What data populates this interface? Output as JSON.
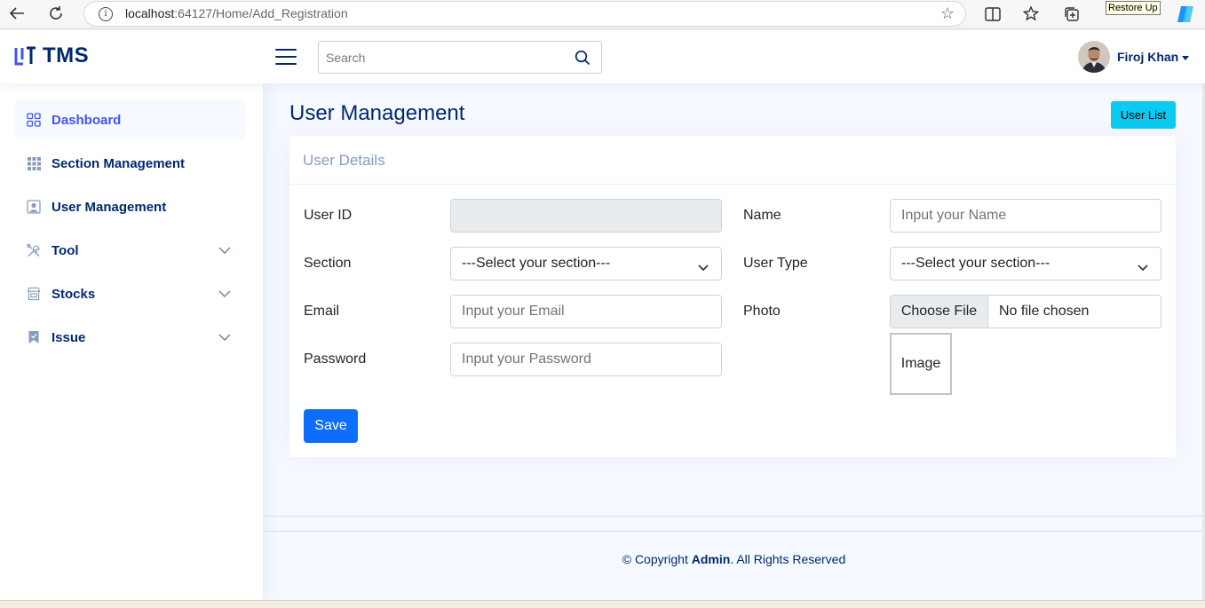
{
  "browser": {
    "url_host": "localhost",
    "url_path": ":64127/Home/Add_Registration",
    "tooltip": "Restore Up"
  },
  "header": {
    "logo_text": "TMS",
    "search_placeholder": "Search",
    "user_name": "Firoj Khan"
  },
  "sidebar": {
    "items": [
      {
        "label": "Dashboard",
        "icon": "grid-icon",
        "active": true
      },
      {
        "label": "Section Management",
        "icon": "apps-grid-icon"
      },
      {
        "label": "User Management",
        "icon": "person-badge-icon"
      },
      {
        "label": "Tool",
        "icon": "tools-icon",
        "expandable": true
      },
      {
        "label": "Stocks",
        "icon": "shop-icon",
        "expandable": true
      },
      {
        "label": "Issue",
        "icon": "bookmark-icon",
        "expandable": true
      }
    ]
  },
  "main": {
    "title": "User Management",
    "user_list_button": "User List",
    "card_title": "User Details",
    "fields": {
      "user_id_label": "User ID",
      "user_id_value": "",
      "name_label": "Name",
      "name_placeholder": "Input your Name",
      "section_label": "Section",
      "section_value": "---Select your section---",
      "user_type_label": "User Type",
      "user_type_value": "---Select your section---",
      "email_label": "Email",
      "email_placeholder": "Input your Email",
      "photo_label": "Photo",
      "file_button": "Choose File",
      "file_status": "No file chosen",
      "password_label": "Password",
      "password_placeholder": "Input your Password",
      "image_placeholder": "Image"
    },
    "save_button": "Save"
  },
  "footer": {
    "prefix": "© Copyright ",
    "owner": "Admin",
    "suffix": ". All Rights Reserved"
  },
  "colors": {
    "primary": "#012970",
    "accent": "#4154f1",
    "save_button": "#0d6efd",
    "user_list_button": "#0dcaf0"
  }
}
